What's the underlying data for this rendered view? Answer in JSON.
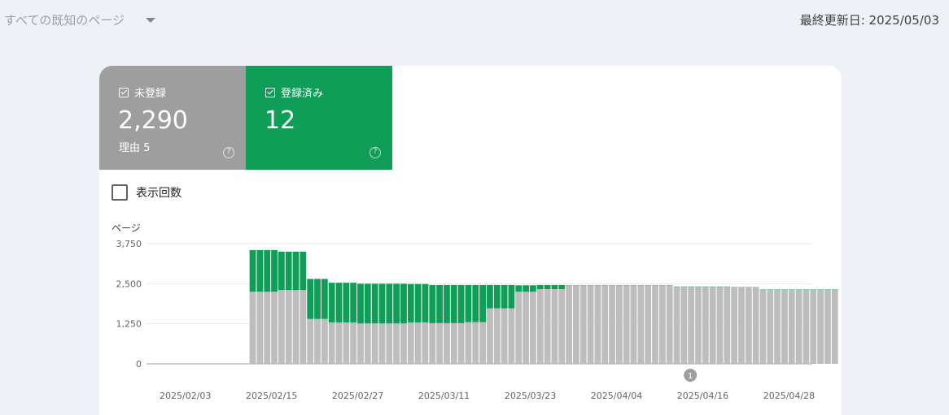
{
  "header": {
    "dropdown_label": "すべての既知のページ",
    "last_updated": "最終更新日: 2025/05/03"
  },
  "tiles": [
    {
      "label": "未登録",
      "value": "2,290",
      "sub": "理由 5",
      "color": "#9e9e9e"
    },
    {
      "label": "登録済み",
      "value": "12",
      "sub": "",
      "color": "#0f9d58"
    }
  ],
  "impressions_label": "表示回数",
  "icons": {
    "dropdown": "chevron-down-icon",
    "check": "checkbox-checked-icon",
    "help": "help-circle-icon",
    "annotation": "annotation-marker-icon"
  },
  "chart_data": {
    "type": "bar",
    "stacked": true,
    "ylabel": "ページ",
    "yticks": [
      "0",
      "1,250",
      "2,500",
      "3,750"
    ],
    "ylim": [
      0,
      3750
    ],
    "xticks": [
      "2025/02/03",
      "2025/02/15",
      "2025/02/27",
      "2025/03/11",
      "2025/03/23",
      "2025/04/04",
      "2025/04/16",
      "2025/04/28"
    ],
    "annotation": {
      "label": "1",
      "date": "2025/04/13"
    },
    "colors": {
      "not_indexed": "#bdbdbd",
      "indexed": "#0f9d58"
    },
    "x": [
      "2025/02/03",
      "2025/02/04",
      "2025/02/05",
      "2025/02/06",
      "2025/02/07",
      "2025/02/08",
      "2025/02/09",
      "2025/02/10",
      "2025/02/11",
      "2025/02/12",
      "2025/02/13",
      "2025/02/14",
      "2025/02/15",
      "2025/02/16",
      "2025/02/17",
      "2025/02/18",
      "2025/02/19",
      "2025/02/20",
      "2025/02/21",
      "2025/02/22",
      "2025/02/23",
      "2025/02/24",
      "2025/02/25",
      "2025/02/26",
      "2025/02/27",
      "2025/02/28",
      "2025/03/01",
      "2025/03/02",
      "2025/03/03",
      "2025/03/04",
      "2025/03/05",
      "2025/03/06",
      "2025/03/07",
      "2025/03/08",
      "2025/03/09",
      "2025/03/10",
      "2025/03/11",
      "2025/03/12",
      "2025/03/13",
      "2025/03/14",
      "2025/03/15",
      "2025/03/16",
      "2025/03/17",
      "2025/03/18",
      "2025/03/19",
      "2025/03/20",
      "2025/03/21",
      "2025/03/22",
      "2025/03/23",
      "2025/03/24",
      "2025/03/25",
      "2025/03/26",
      "2025/03/27",
      "2025/03/28",
      "2025/03/29",
      "2025/03/30",
      "2025/03/31",
      "2025/04/01",
      "2025/04/02",
      "2025/04/03",
      "2025/04/04",
      "2025/04/05",
      "2025/04/06",
      "2025/04/07",
      "2025/04/08",
      "2025/04/09",
      "2025/04/10",
      "2025/04/11",
      "2025/04/12",
      "2025/04/13",
      "2025/04/14",
      "2025/04/15",
      "2025/04/16",
      "2025/04/17",
      "2025/04/18",
      "2025/04/19",
      "2025/04/20",
      "2025/04/21",
      "2025/04/22",
      "2025/04/23",
      "2025/04/24",
      "2025/04/25",
      "2025/04/26",
      "2025/04/27",
      "2025/04/28",
      "2025/04/29",
      "2025/04/30",
      "2025/05/01",
      "2025/05/02",
      "2025/05/03"
    ],
    "series": [
      {
        "name": "未登録",
        "values": [
          null,
          null,
          null,
          null,
          null,
          null,
          null,
          null,
          2250,
          2250,
          2250,
          2250,
          2300,
          2300,
          2300,
          2300,
          1400,
          1400,
          1400,
          1290,
          1290,
          1290,
          1290,
          1260,
          1260,
          1260,
          1260,
          1260,
          1260,
          1260,
          1290,
          1290,
          1290,
          1270,
          1270,
          1270,
          1270,
          1270,
          1300,
          1300,
          1300,
          1730,
          1730,
          1730,
          1730,
          2250,
          2250,
          2250,
          2330,
          2330,
          2330,
          2330,
          2440,
          2440,
          2440,
          2440,
          2440,
          2440,
          2440,
          2440,
          2440,
          2440,
          2440,
          2440,
          2440,
          2440,
          2440,
          2400,
          2400,
          2400,
          2400,
          2400,
          2400,
          2400,
          2400,
          2380,
          2380,
          2380,
          2380,
          2310,
          2310,
          2310,
          2310,
          2310,
          2310,
          2310,
          2310,
          2310,
          2310,
          2310,
          2310,
          2310,
          2310,
          2300,
          2300,
          2300,
          2300,
          2300,
          2300,
          2300,
          2300,
          2290,
          2290,
          2290,
          2290,
          2290
        ]
      },
      {
        "name": "登録済み",
        "values": [
          null,
          null,
          null,
          null,
          null,
          null,
          null,
          null,
          1300,
          1300,
          1300,
          1300,
          1200,
          1200,
          1200,
          1200,
          1250,
          1250,
          1250,
          1240,
          1240,
          1240,
          1240,
          1240,
          1240,
          1240,
          1240,
          1240,
          1240,
          1240,
          1200,
          1200,
          1200,
          1190,
          1190,
          1190,
          1190,
          1190,
          1160,
          1160,
          1160,
          730,
          730,
          730,
          730,
          200,
          200,
          200,
          130,
          130,
          130,
          130,
          12,
          12,
          12,
          12,
          12,
          12,
          12,
          12,
          12,
          12,
          12,
          12,
          12,
          12,
          12,
          12,
          12,
          12,
          12,
          12,
          12,
          12,
          12,
          12,
          12,
          12,
          12,
          12,
          12,
          12,
          12,
          12,
          12,
          12,
          12,
          12,
          12,
          12,
          12,
          12,
          12,
          12,
          12,
          12,
          12,
          12,
          12,
          12,
          12,
          12,
          12,
          12,
          12,
          12,
          12
        ]
      }
    ]
  }
}
